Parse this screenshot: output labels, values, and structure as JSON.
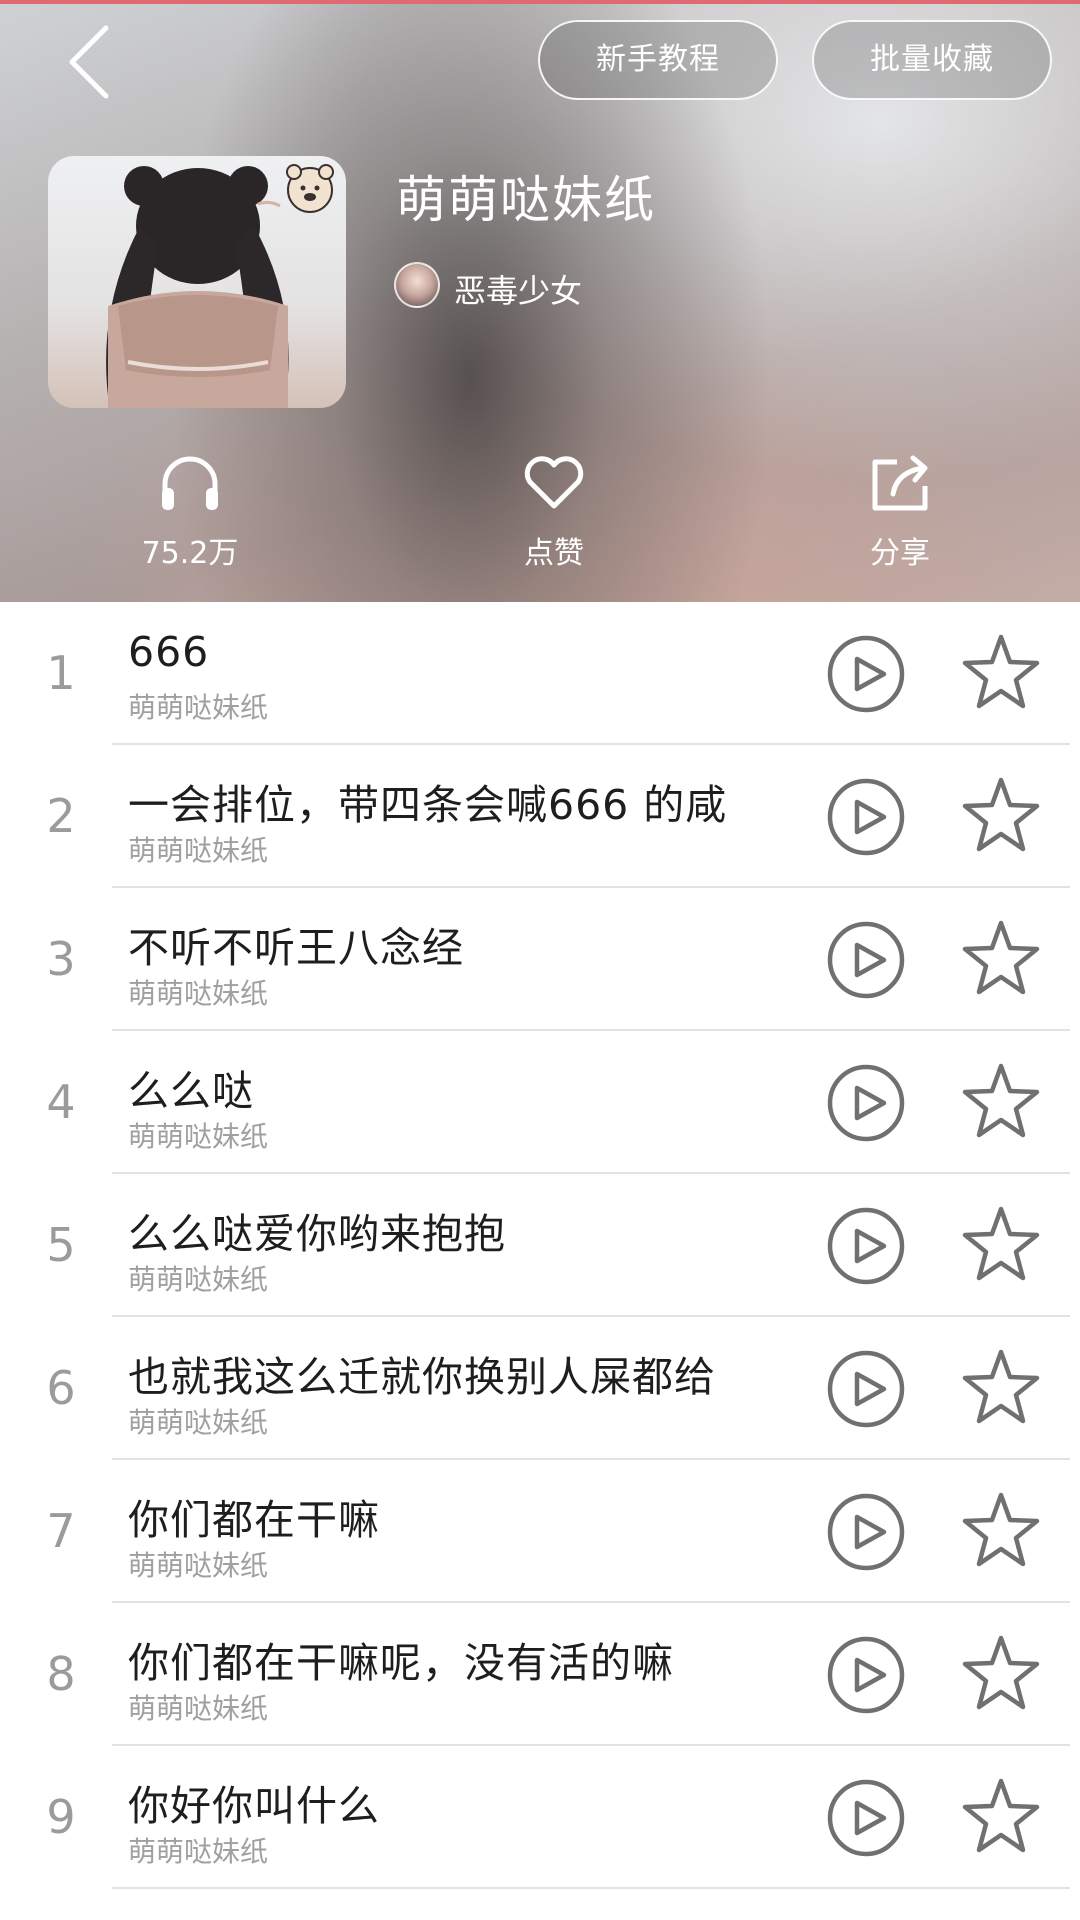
{
  "header": {
    "back_icon": "back-chevron-icon",
    "tutorial_label": "新手教程",
    "batch_collect_label": "批量收藏",
    "album_title": "萌萌哒妹纸",
    "author_name": "恶毒少女",
    "stats": {
      "plays_label": "75.2万",
      "like_label": "点赞",
      "share_label": "分享"
    }
  },
  "songs": [
    {
      "index": "1",
      "title": "666",
      "artist": "萌萌哒妹纸"
    },
    {
      "index": "2",
      "title": "一会排位，带四条会喊666 的咸",
      "artist": "萌萌哒妹纸"
    },
    {
      "index": "3",
      "title": "不听不听王八念经",
      "artist": "萌萌哒妹纸"
    },
    {
      "index": "4",
      "title": "么么哒",
      "artist": "萌萌哒妹纸"
    },
    {
      "index": "5",
      "title": "么么哒爱你哟来抱抱",
      "artist": "萌萌哒妹纸"
    },
    {
      "index": "6",
      "title": "也就我这么迁就你换别人屎都给",
      "artist": "萌萌哒妹纸"
    },
    {
      "index": "7",
      "title": "你们都在干嘛",
      "artist": "萌萌哒妹纸"
    },
    {
      "index": "8",
      "title": "你们都在干嘛呢，没有活的嘛",
      "artist": "萌萌哒妹纸"
    },
    {
      "index": "9",
      "title": "你好你叫什么",
      "artist": "萌萌哒妹纸"
    }
  ],
  "colors": {
    "accent_top_line": "#e06a72",
    "icon_gray": "#707070",
    "index_gray": "#9b9b9b",
    "subtitle_gray": "#a0a0a0"
  }
}
